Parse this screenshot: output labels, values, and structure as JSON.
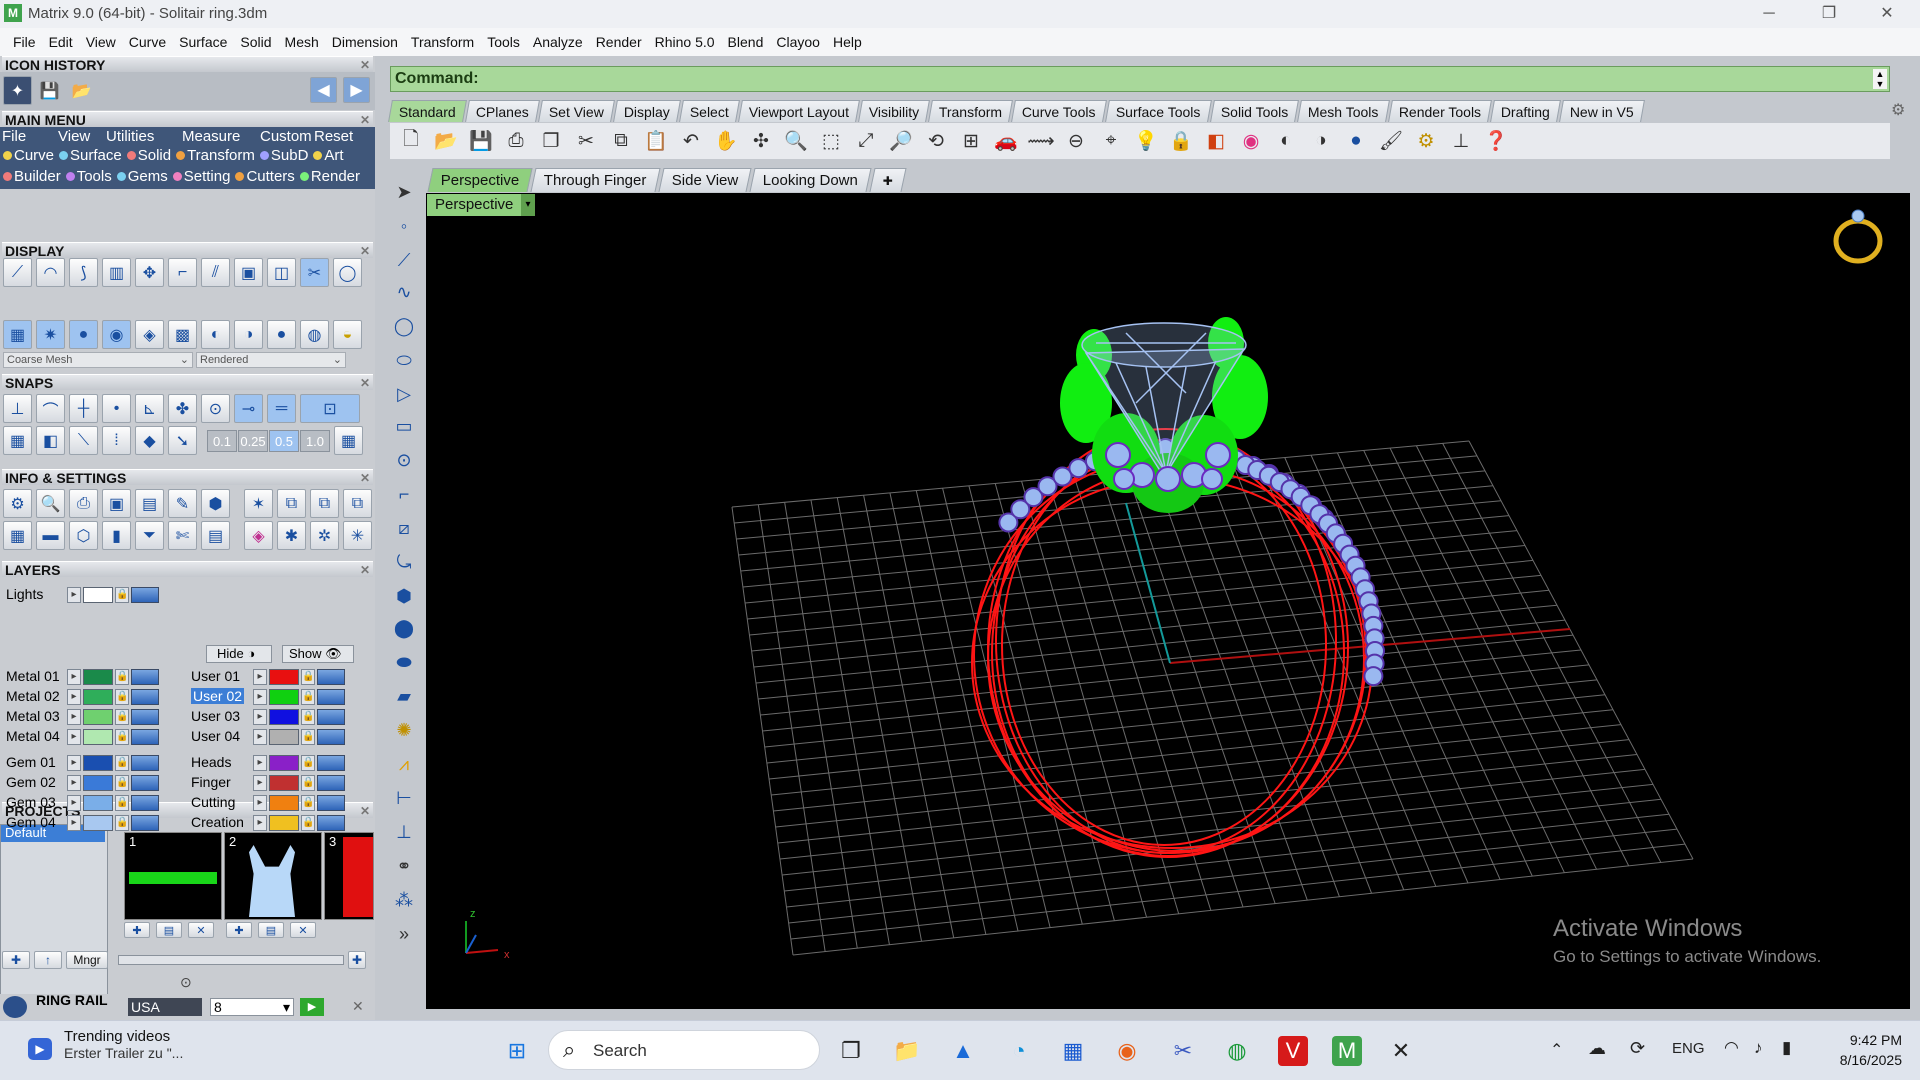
{
  "window": {
    "title": "Matrix 9.0 (64-bit) - Solitair ring.3dm",
    "app_icon": "M"
  },
  "menu": [
    "File",
    "Edit",
    "View",
    "Curve",
    "Surface",
    "Solid",
    "Mesh",
    "Dimension",
    "Transform",
    "Tools",
    "Analyze",
    "Render",
    "Rhino 5.0",
    "Blend",
    "Clayoo",
    "Help"
  ],
  "panels": {
    "icon_history": "ICON HISTORY",
    "main_menu": "MAIN MENU",
    "display": "DISPLAY",
    "snaps": "SNAPS",
    "info_settings": "INFO & SETTINGS",
    "layers": "LAYERS",
    "projects": "PROJECTS",
    "ring": "RING RAIL"
  },
  "main_menu": {
    "top": [
      "File",
      "View",
      "Utilities",
      "Measure",
      "Custom"
    ],
    "reset": "Reset",
    "row1": [
      {
        "label": "Curve",
        "color": "#f0d24a"
      },
      {
        "label": "Surface",
        "color": "#7ad0f0"
      },
      {
        "label": "Solid",
        "color": "#f07a7a"
      },
      {
        "label": "Transform",
        "color": "#f0a040"
      },
      {
        "label": "SubD",
        "color": "#a0a0ff"
      },
      {
        "label": "Art",
        "color": "#f0d24a"
      }
    ],
    "row2": [
      {
        "label": "Builder",
        "color": "#f07a7a"
      },
      {
        "label": "Tools",
        "color": "#c080f0"
      },
      {
        "label": "Gems",
        "color": "#7ad0f0"
      },
      {
        "label": "Setting",
        "color": "#f080c0"
      },
      {
        "label": "Cutters",
        "color": "#f0a040"
      },
      {
        "label": "Render",
        "color": "#7af07a"
      }
    ]
  },
  "display": {
    "mesh": "Coarse Mesh",
    "mode": "Rendered"
  },
  "snaps": {
    "values": [
      "0.1",
      "0.25",
      "0.5",
      "1.0"
    ]
  },
  "layers": {
    "lights": "Lights",
    "hide": "Hide",
    "show": "Show",
    "left": [
      {
        "name": "Metal 01",
        "color": "#1a8a4a"
      },
      {
        "name": "Metal 02",
        "color": "#2fae5a"
      },
      {
        "name": "Metal 03",
        "color": "#6fd06f"
      },
      {
        "name": "Metal 04",
        "color": "#b0e8b0"
      },
      {
        "name": "Gem 01",
        "color": "#1a4fb0"
      },
      {
        "name": "Gem 02",
        "color": "#3a7ad8"
      },
      {
        "name": "Gem 03",
        "color": "#7aaee8"
      },
      {
        "name": "Gem 04",
        "color": "#a8c8f0"
      }
    ],
    "right": [
      {
        "name": "User 01",
        "color": "#e81010",
        "selected": false
      },
      {
        "name": "User 02",
        "color": "#10d010",
        "selected": true
      },
      {
        "name": "User 03",
        "color": "#1010e0",
        "selected": false
      },
      {
        "name": "User 04",
        "color": "#b0b0b0",
        "selected": false
      },
      {
        "name": "Heads",
        "color": "#8a20c8",
        "selected": false
      },
      {
        "name": "Finger",
        "color": "#c03030",
        "selected": false
      },
      {
        "name": "Cutting",
        "color": "#f08010",
        "selected": false
      },
      {
        "name": "Creation",
        "color": "#f0c020",
        "selected": false
      }
    ]
  },
  "projects": {
    "default": "Default",
    "mgr": "Mngr",
    "items": [
      "1",
      "2",
      "3"
    ]
  },
  "ring": {
    "size_system": "USA",
    "size": "8"
  },
  "command": {
    "label": "Command:"
  },
  "toolbar_tabs": [
    "Standard",
    "CPlanes",
    "Set View",
    "Display",
    "Select",
    "Viewport Layout",
    "Visibility",
    "Transform",
    "Curve Tools",
    "Surface Tools",
    "Solid Tools",
    "Mesh Tools",
    "Render Tools",
    "Drafting",
    "New in V5"
  ],
  "viewport_tabs": [
    "Perspective",
    "Through Finger",
    "Side View",
    "Looking Down"
  ],
  "viewport": {
    "label": "Perspective"
  },
  "watermark": {
    "line1": "Activate Windows",
    "line2": "Go to Settings to activate Windows."
  },
  "taskbar": {
    "trending_title": "Trending videos",
    "trending_sub": "Erster Trailer zu \"...",
    "search": "Search",
    "lang": "ENG",
    "time": "9:42 PM",
    "date": "8/16/2025"
  }
}
